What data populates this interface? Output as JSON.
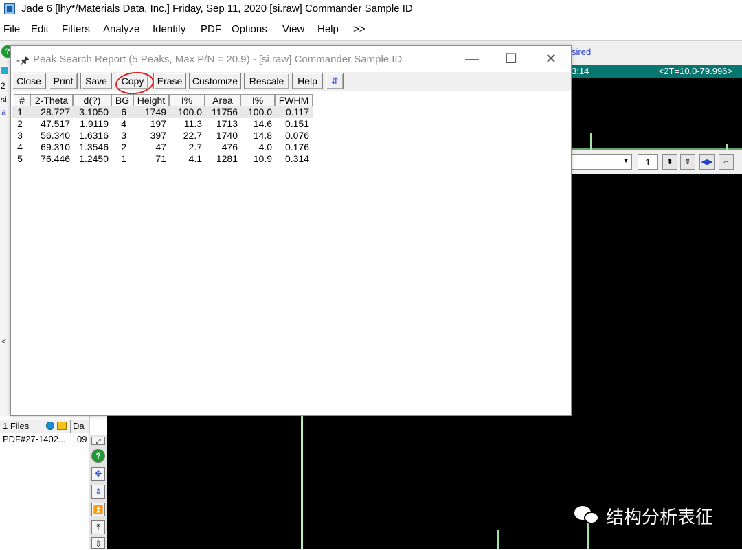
{
  "app": {
    "title": "Jade 6 [lhy*/Materials Data, Inc.] Friday, Sep 11, 2020 [si.raw] Commander Sample ID",
    "menu": [
      "File",
      "Edit",
      "Filters",
      "Analyze",
      "Identify",
      "PDF",
      "Options",
      "View",
      "Help",
      ">>"
    ],
    "status_text": "sired",
    "left_panel": {
      "t1": "2",
      "t2": "si",
      "t3": "a",
      "arrow": "<"
    }
  },
  "chart": {
    "header_left": "3:14",
    "header_right": "<2T=10.0-79.996>",
    "page_number": "1",
    "colors": {
      "background": "#000000",
      "header": "#06766f",
      "trace": "#b5f0b5"
    }
  },
  "files": {
    "header": "1 Files",
    "date_header": "Da",
    "row_name": "PDF#27-1402...",
    "row_date": "09"
  },
  "watermark": "结构分析表征",
  "dialog": {
    "pin_icon": "-🖈",
    "title": "Peak Search Report (5 Peaks, Max P/N = 20.9) - [si.raw] Commander Sample ID",
    "controls": {
      "minimize": "—",
      "maximize": "☐",
      "close": "✕"
    },
    "buttons": {
      "close": "Close",
      "print": "Print",
      "save": "Save",
      "copy": "Copy",
      "erase": "Erase",
      "customize": "Customize",
      "rescale": "Rescale",
      "help": "Help"
    },
    "columns": [
      "#",
      "2-Theta",
      "d(?)",
      "BG",
      "Height",
      "I%",
      "Area",
      "I%",
      "FWHM"
    ],
    "rows": [
      [
        "1",
        "28.727",
        "3.1050",
        "6",
        "1749",
        "100.0",
        "11756",
        "100.0",
        "0.117"
      ],
      [
        "2",
        "47.517",
        "1.9119",
        "4",
        "197",
        "11.3",
        "1713",
        "14.6",
        "0.151"
      ],
      [
        "3",
        "56.340",
        "1.6316",
        "3",
        "397",
        "22.7",
        "1740",
        "14.8",
        "0.076"
      ],
      [
        "4",
        "69.310",
        "1.3546",
        "2",
        "47",
        "2.7",
        "476",
        "4.0",
        "0.176"
      ],
      [
        "5",
        "76.446",
        "1.2450",
        "1",
        "71",
        "4.1",
        "1281",
        "10.9",
        "0.314"
      ]
    ],
    "highlight_color": "#e02020"
  }
}
